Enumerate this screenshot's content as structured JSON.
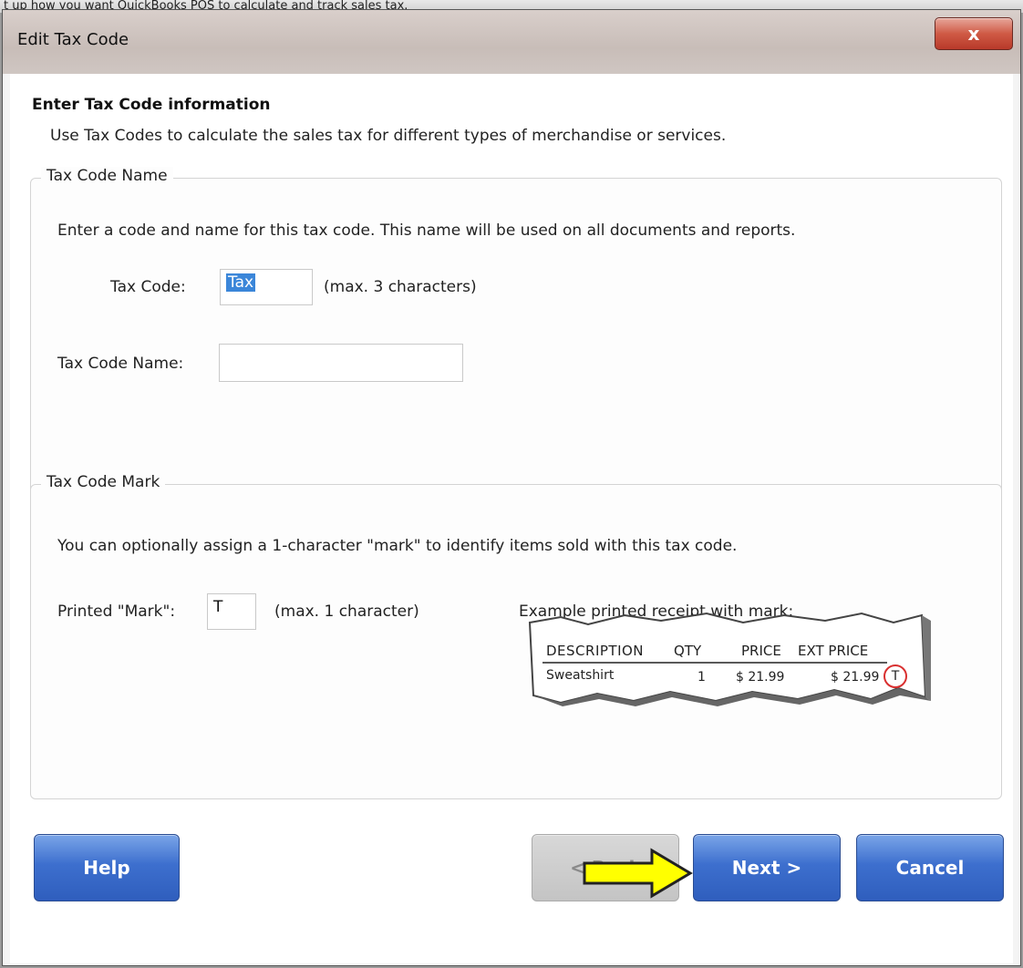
{
  "background_text": "t up how you want QuickBooks POS to calculate and track sales tax.",
  "dialog": {
    "title": "Edit Tax Code",
    "close_glyph": "x"
  },
  "page": {
    "heading": "Enter Tax Code information",
    "intro": "Use Tax Codes to calculate the sales tax for different types of merchandise or services."
  },
  "tax_code_name_group": {
    "legend": "Tax Code Name",
    "description": "Enter a code and name for this tax code. This name will be used on all documents and reports.",
    "tax_code_label": "Tax Code:",
    "tax_code_value": "Tax",
    "tax_code_hint": "(max. 3 characters)",
    "tax_code_name_label": "Tax Code Name:",
    "tax_code_name_value": ""
  },
  "tax_code_mark_group": {
    "legend": "Tax Code Mark",
    "description": "You can optionally assign a 1-character \"mark\" to identify items sold with this tax code.",
    "mark_label": "Printed \"Mark\":",
    "mark_value": "T",
    "mark_hint": "(max. 1 character)",
    "example_label": "Example printed receipt with mark:",
    "receipt": {
      "headers": [
        "DESCRIPTION",
        "QTY",
        "PRICE",
        "EXT PRICE"
      ],
      "row": [
        "Sweatshirt",
        "1",
        "$ 21.99",
        "$ 21.99"
      ],
      "mark": "T"
    }
  },
  "buttons": {
    "help": "Help",
    "back": "< Back",
    "next": "Next >",
    "cancel": "Cancel"
  },
  "colors": {
    "button_blue": "#3d6fce",
    "selection_blue": "#3b86d9",
    "arrow_yellow": "#ffff00",
    "mark_circle_red": "#d93030",
    "close_red": "#cf5a45"
  }
}
